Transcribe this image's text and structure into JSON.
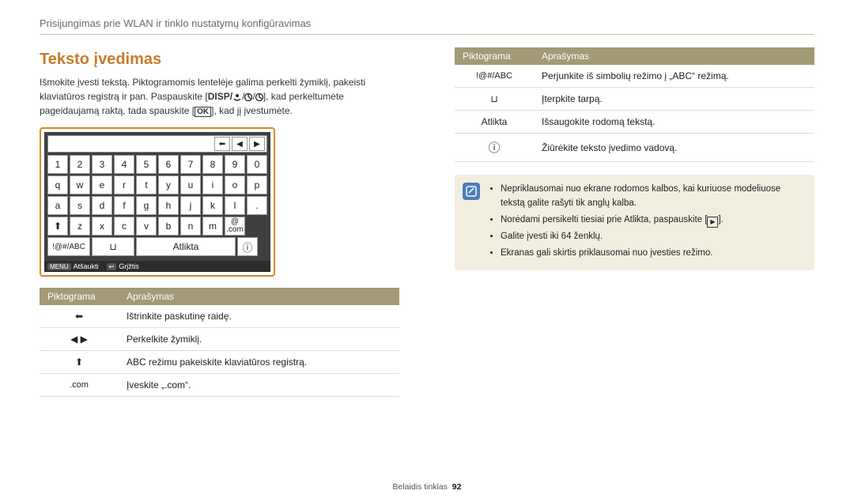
{
  "header": "Prisijungimas prie WLAN ir tinklo nustatymų konfigūravimas",
  "title": "Teksto įvedimas",
  "intro": {
    "p1a": "Išmokite įvesti tekstą. Piktogramomis lentelėje galima perkelti žymiklį, pakeisti klaviatūros registrą ir pan. Paspauskite [",
    "disp": "DISP/",
    "p1b": "], kad perkeltumėte pageidaujamą raktą, tada spauskite [",
    "ok": "OK",
    "p1c": "], kad jį įvestumėte."
  },
  "keyboard": {
    "r1": [
      "1",
      "2",
      "3",
      "4",
      "5",
      "6",
      "7",
      "8",
      "9",
      "0"
    ],
    "r2": [
      "q",
      "w",
      "e",
      "r",
      "t",
      "y",
      "u",
      "i",
      "o",
      "p"
    ],
    "r3": [
      "a",
      "s",
      "d",
      "f",
      "g",
      "h",
      "j",
      "k",
      "l",
      "."
    ],
    "r4": [
      "z",
      "x",
      "c",
      "v",
      "b",
      "n",
      "m"
    ],
    "abc": "!@#/ABC",
    "done": "Atlikta",
    "menu": "MENU",
    "cancel": "Atšaukti",
    "back_icon": "↩",
    "back": "Grįžtis"
  },
  "tableL": {
    "th1": "Piktograma",
    "th2": "Aprašymas",
    "rows": [
      {
        "icon": "⬅",
        "text": "Ištrinkite paskutinę raidę."
      },
      {
        "icon": "◀  ▶",
        "text": "Perkelkite žymiklį."
      },
      {
        "icon": "⬆",
        "text": "ABC režimu pakeiskite klaviatūros registrą."
      },
      {
        "icon": ".com",
        "text": "Įveskite „.com“."
      }
    ]
  },
  "tableR": {
    "th1": "Piktograma",
    "th2": "Aprašymas",
    "rows": [
      {
        "icon": "!@#/ABC",
        "text": "Perjunkite iš simbolių režimo į „ABC“ režimą."
      },
      {
        "icon": "⊔",
        "text": "Įterpkite tarpą."
      },
      {
        "icon": "Atlikta",
        "text": "Išsaugokite rodomą tekstą."
      },
      {
        "icon": "ⓘ",
        "text": "Žiūrėkite teksto įvedimo vadovą."
      }
    ]
  },
  "note": {
    "items": [
      "Nepriklausomai nuo ekrane rodomos kalbos, kai kuriuose modeliuose tekstą galite rašyti tik anglų kalba.",
      "Norėdami persikelti tiesiai prie Atlikta, paspauskite [",
      "Galite įvesti iki 64 ženklų.",
      "Ekranas gali skirtis priklausomai nuo įvesties režimo."
    ],
    "item2suffix": "]."
  },
  "footer": {
    "section": "Belaidis tinklas",
    "page": "92"
  }
}
